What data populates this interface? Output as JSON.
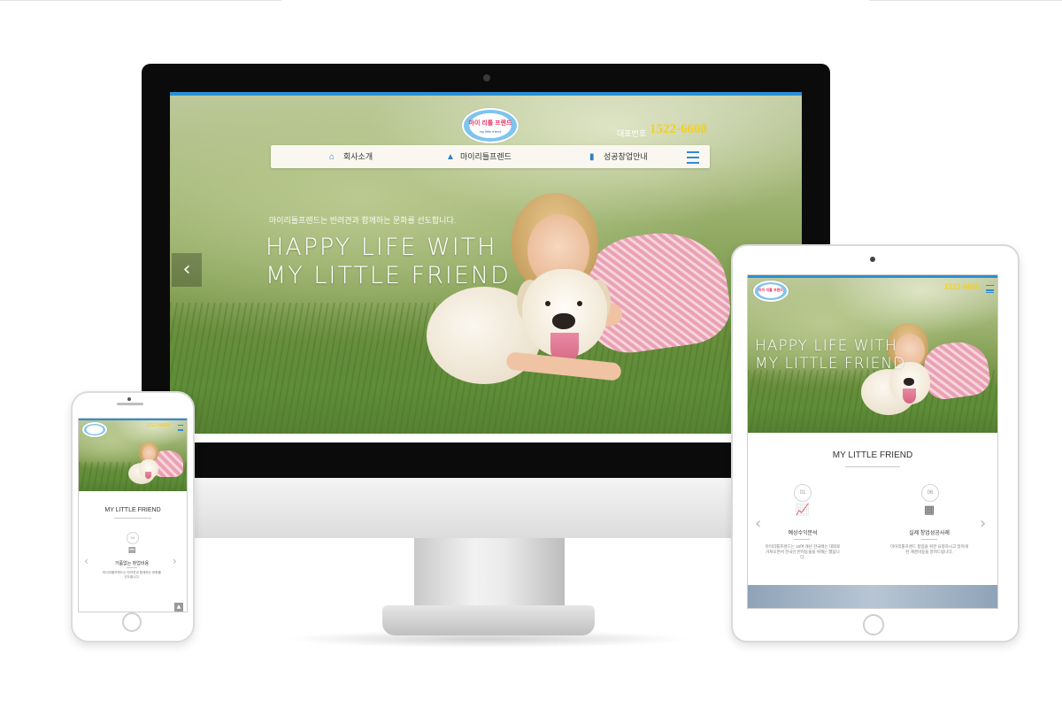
{
  "desktop": {
    "phone_label": "대표번호",
    "phone_number": "1522-6608",
    "logo_text": "마이 리틀 프렌드",
    "logo_sub": "my little friend",
    "nav": [
      {
        "label": "회사소개",
        "icon": "home-icon"
      },
      {
        "label": "마이리틀프렌드",
        "icon": "dog-icon"
      },
      {
        "label": "성공창업안내",
        "icon": "bar-chart-icon"
      }
    ],
    "hero_subtitle": "마이리틀프렌드는 반려견과 함께하는 문화를 선도합니다.",
    "hero_title_line1": "HAPPY LIFE WITH",
    "hero_title_line2": "MY LITTLE FRIEND"
  },
  "tablet": {
    "phone_number": "1522-6608",
    "hero_title_line1": "HAPPY LIFE WITH",
    "hero_title_line2": "MY LITTLE FRIEND",
    "section_title": "MY LITTLE FRIEND",
    "features": [
      {
        "num": "01",
        "title": "예상수익분석",
        "desc": "마이리틀프렌드는 10여 개년 한국에는 대외로 거쳐오면서 한국인 반려동물을 위해는 했답니다.",
        "icon": "growth-chart-icon"
      },
      {
        "num": "06",
        "title": "실제 창업성공사례",
        "desc": "마이리틀프렌드 창업을 위한 요청하시고 알려게된 계경비용을 알려드립니다.",
        "icon": "presenter-icon"
      }
    ]
  },
  "phone": {
    "phone_number": "1522-6608",
    "section_title": "MY LITTLE FRIEND",
    "feature": {
      "num": "04",
      "title": "거품없는 창업비용",
      "desc": "마이리틀프렌드는 반려견과 함께하는 문화를 선도합니다.",
      "icon": "money-icon"
    }
  },
  "colors": {
    "accent_blue": "#2b8fd6",
    "phone_yellow": "#f4d01e",
    "nav_bg": "#faf7f0"
  }
}
